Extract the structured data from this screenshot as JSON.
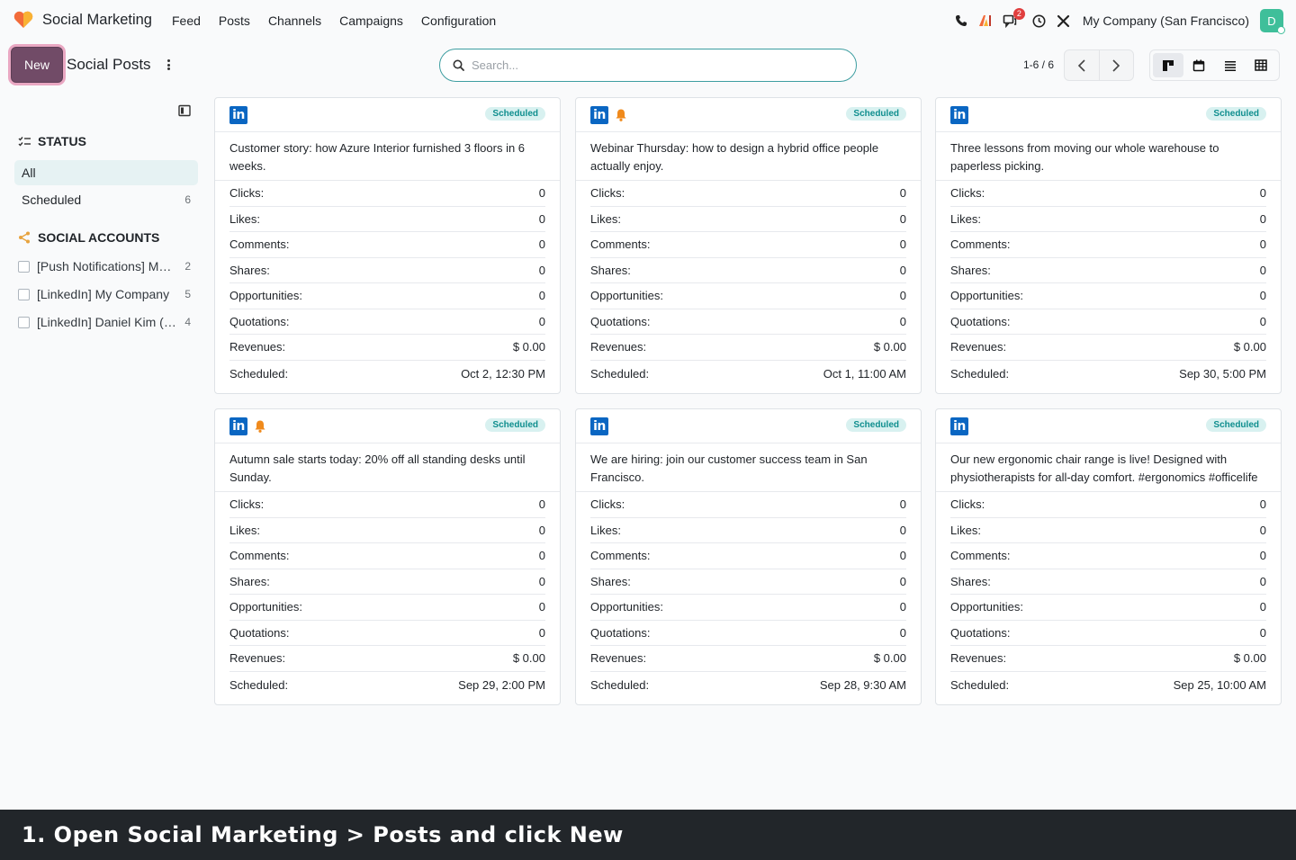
{
  "app": {
    "name": "Social Marketing"
  },
  "menu": [
    "Feed",
    "Posts",
    "Channels",
    "Campaigns",
    "Configuration"
  ],
  "systray": {
    "company": "My Company (San Francisco)",
    "messages_badge": "2",
    "avatar_letter": "D"
  },
  "control": {
    "new_label": "New",
    "title": "Social Posts",
    "search_placeholder": "Search...",
    "pager": "1-6 / 6"
  },
  "sidebar": {
    "status_heading": "STATUS",
    "status_items": [
      {
        "label": "All",
        "count": ""
      },
      {
        "label": "Scheduled",
        "count": "6"
      }
    ],
    "accounts_heading": "SOCIAL ACCOUNTS",
    "accounts": [
      {
        "label": "[Push Notifications] My Company",
        "count": "2"
      },
      {
        "label": "[LinkedIn] My Company",
        "count": "5"
      },
      {
        "label": "[LinkedIn] Daniel Kim (My Company)",
        "count": "4"
      }
    ]
  },
  "stat_labels": [
    "Clicks:",
    "Likes:",
    "Comments:",
    "Shares:",
    "Opportunities:",
    "Quotations:",
    "Revenues:",
    "Scheduled:"
  ],
  "posts": [
    {
      "status": "Scheduled",
      "bell": false,
      "message": "Customer story: how Azure Interior furnished 3 floors in 6 weeks.",
      "values": [
        "0",
        "0",
        "0",
        "0",
        "0",
        "0",
        "$ 0.00",
        "Oct 2, 12:30 PM"
      ]
    },
    {
      "status": "Scheduled",
      "bell": true,
      "message": "Webinar Thursday: how to design a hybrid office people actually enjoy.",
      "values": [
        "0",
        "0",
        "0",
        "0",
        "0",
        "0",
        "$ 0.00",
        "Oct 1, 11:00 AM"
      ]
    },
    {
      "status": "Scheduled",
      "bell": false,
      "message": "Three lessons from moving our whole warehouse to paperless picking.",
      "values": [
        "0",
        "0",
        "0",
        "0",
        "0",
        "0",
        "$ 0.00",
        "Sep 30, 5:00 PM"
      ]
    },
    {
      "status": "Scheduled",
      "bell": true,
      "message": "Autumn sale starts today: 20% off all standing desks until Sunday.",
      "values": [
        "0",
        "0",
        "0",
        "0",
        "0",
        "0",
        "$ 0.00",
        "Sep 29, 2:00 PM"
      ]
    },
    {
      "status": "Scheduled",
      "bell": false,
      "message": "We are hiring: join our customer success team in San Francisco.",
      "values": [
        "0",
        "0",
        "0",
        "0",
        "0",
        "0",
        "$ 0.00",
        "Sep 28, 9:30 AM"
      ]
    },
    {
      "status": "Scheduled",
      "bell": false,
      "message": "Our new ergonomic chair range is live! Designed with physiotherapists for all-day comfort. #ergonomics #officelife",
      "values": [
        "0",
        "0",
        "0",
        "0",
        "0",
        "0",
        "$ 0.00",
        "Sep 25, 10:00 AM"
      ]
    }
  ],
  "caption": "1. Open Social Marketing > Posts and click New"
}
